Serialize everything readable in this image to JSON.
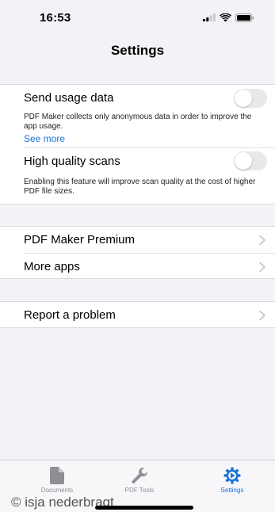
{
  "status_bar": {
    "time": "16:53"
  },
  "nav": {
    "title": "Settings"
  },
  "privacy_group": {
    "usage_label": "Send usage data",
    "usage_desc": "PDF Maker collects only anonymous data in order to improve the app usage.",
    "see_more": "See more",
    "usage_on": false,
    "hq_label": "High quality scans",
    "hq_desc": "Enabling this feature will improve scan quality at the cost of higher PDF file sizes.",
    "hq_on": false
  },
  "links_group": {
    "premium": "PDF Maker Premium",
    "more_apps": "More apps"
  },
  "support_group": {
    "report": "Report a problem"
  },
  "tab_bar": {
    "tabs": [
      {
        "label": "Documents",
        "icon": "document-icon",
        "active": false
      },
      {
        "label": "PDF Tools",
        "icon": "wrench-icon",
        "active": false
      },
      {
        "label": "Settings",
        "icon": "gear-icon",
        "active": true
      }
    ]
  },
  "watermark": "© isja nederbragt",
  "colors": {
    "accent": "#1a73d8",
    "background": "#f2f2f7"
  }
}
